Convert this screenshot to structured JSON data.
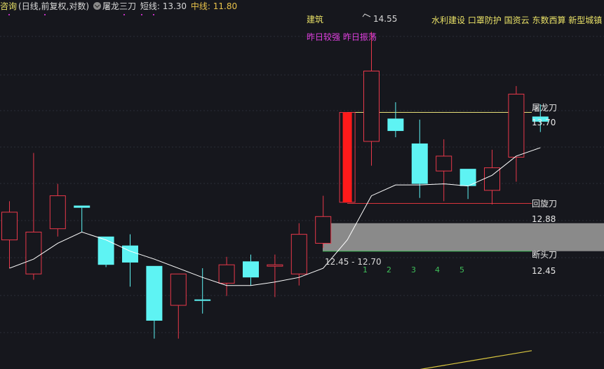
{
  "header": {
    "query_label": "咨询",
    "period_label": "(日线,前复权,对数)",
    "indicator_name": "屠龙三刀",
    "short_line_label": "短线: 13.30",
    "mid_line_label": "中线: 11.80"
  },
  "annotations": {
    "sector": "建筑",
    "concepts": "水利建设 口罩防护 国资云 东数西算 新型城镇",
    "flags": "昨日较强 昨日振荡",
    "high_price": "14.55",
    "zone_range": "12.45 - 12.70"
  },
  "levels": [
    {
      "name": "屠龙刀",
      "value": "13.70"
    },
    {
      "name": "回旋刀",
      "value": "12.88"
    },
    {
      "name": "断头刀",
      "value": "12.45"
    }
  ],
  "day_counts": [
    "1",
    "2",
    "3",
    "4",
    "5"
  ],
  "colors": {
    "up": "#e8384a",
    "down": "#5ef3f3",
    "limit_up": "#ff1a1a",
    "ma": "#ffffff",
    "long_ma": "#d9c640",
    "level_top": "#e8e07a",
    "level_mid": "#d8343c",
    "level_low": "#3fbf5a",
    "zone": "#8a8a8a"
  },
  "chart_data": {
    "type": "candlestick",
    "scale": "log",
    "ylim": [
      11.45,
      14.75
    ],
    "candles": [
      {
        "o": 12.55,
        "h": 12.9,
        "l": 12.3,
        "c": 12.8
      },
      {
        "o": 12.25,
        "h": 13.35,
        "l": 12.2,
        "c": 12.62
      },
      {
        "o": 12.65,
        "h": 13.06,
        "l": 12.58,
        "c": 12.95
      },
      {
        "o": 12.86,
        "h": 12.86,
        "l": 12.62,
        "c": 12.84
      },
      {
        "o": 12.58,
        "h": 12.58,
        "l": 12.31,
        "c": 12.33
      },
      {
        "o": 12.5,
        "h": 12.6,
        "l": 12.14,
        "c": 12.35
      },
      {
        "o": 12.32,
        "h": 12.32,
        "l": 11.7,
        "c": 11.85
      },
      {
        "o": 11.98,
        "h": 12.23,
        "l": 11.7,
        "c": 12.25
      },
      {
        "o": 12.03,
        "h": 12.3,
        "l": 11.91,
        "c": 12.02
      },
      {
        "o": 12.17,
        "h": 12.4,
        "l": 12.06,
        "c": 12.33
      },
      {
        "o": 12.36,
        "h": 12.42,
        "l": 12.15,
        "c": 12.22
      },
      {
        "o": 12.32,
        "h": 12.42,
        "l": 12.05,
        "c": 12.33
      },
      {
        "o": 12.25,
        "h": 12.7,
        "l": 12.15,
        "c": 12.6
      },
      {
        "o": 12.52,
        "h": 12.95,
        "l": 12.48,
        "c": 12.76
      },
      {
        "o": 12.89,
        "h": 13.74,
        "l": 12.89,
        "c": 13.74
      },
      {
        "o": 13.46,
        "h": 14.55,
        "l": 13.23,
        "c": 14.15
      },
      {
        "o": 13.68,
        "h": 13.84,
        "l": 13.5,
        "c": 13.56
      },
      {
        "o": 13.44,
        "h": 13.67,
        "l": 12.93,
        "c": 13.06
      },
      {
        "o": 13.18,
        "h": 13.48,
        "l": 12.9,
        "c": 13.32
      },
      {
        "o": 13.2,
        "h": 13.2,
        "l": 12.92,
        "c": 13.04
      },
      {
        "o": 13.0,
        "h": 13.38,
        "l": 12.87,
        "c": 13.21
      },
      {
        "o": 13.31,
        "h": 14.0,
        "l": 13.08,
        "c": 13.92
      },
      {
        "o": 13.7,
        "h": 13.82,
        "l": 13.55,
        "c": 13.65
      }
    ],
    "ma_short": [
      12.3,
      12.38,
      12.52,
      12.62,
      12.55,
      12.45,
      12.38,
      12.3,
      12.22,
      12.15,
      12.15,
      12.18,
      12.22,
      12.3,
      12.55,
      12.95,
      13.05,
      13.05,
      13.06,
      13.04,
      13.14,
      13.32,
      13.4
    ],
    "ma_long": [
      11.4,
      11.44,
      11.48,
      11.52,
      11.56,
      11.6
    ]
  }
}
